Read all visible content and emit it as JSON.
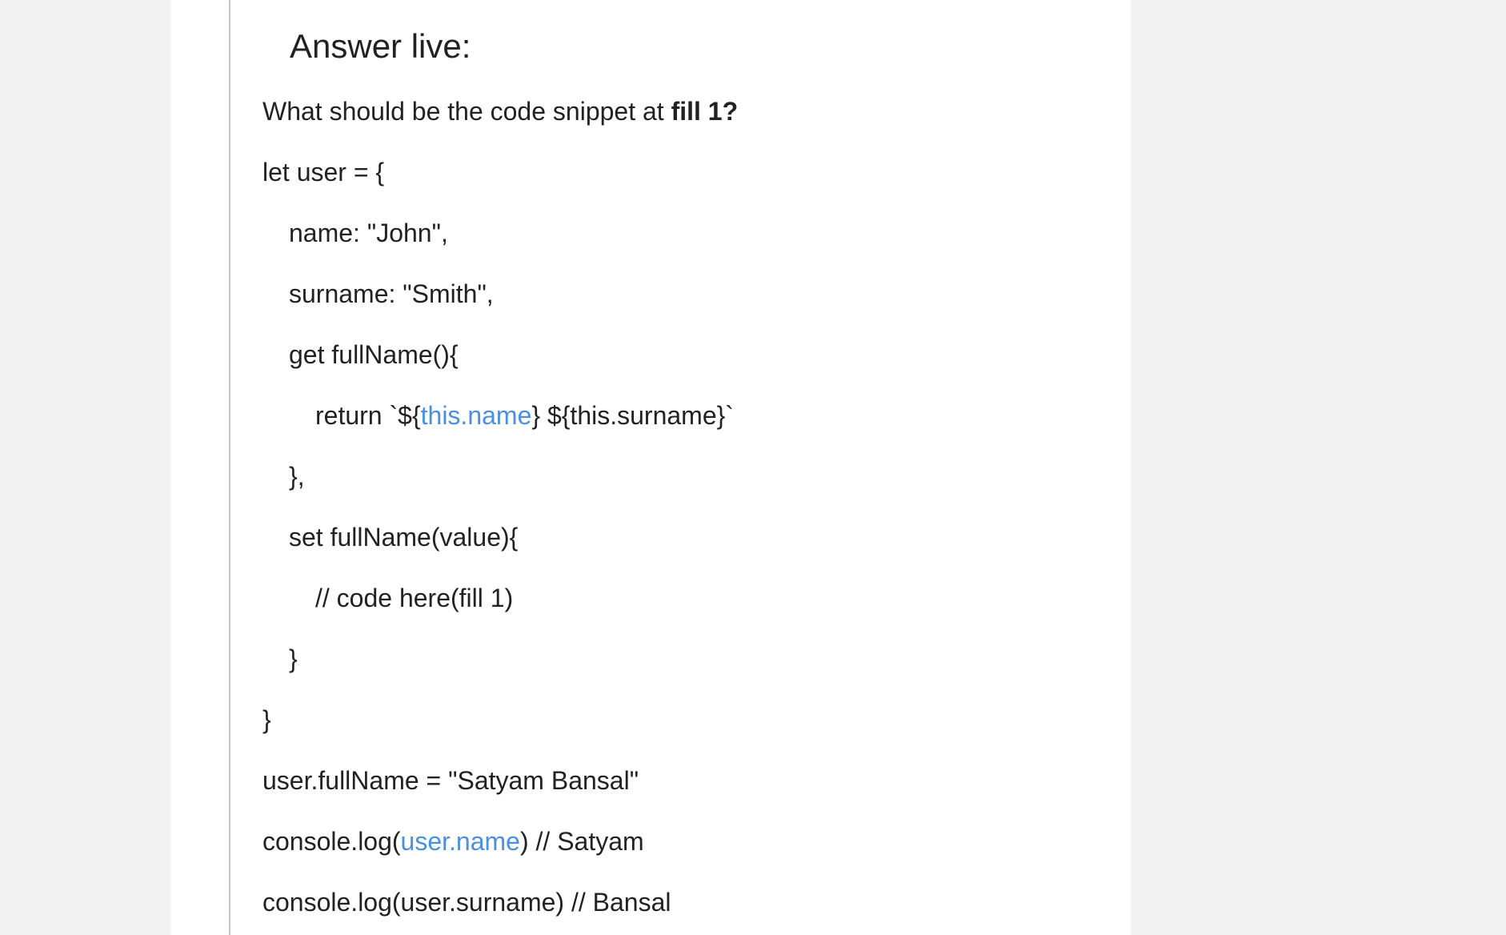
{
  "answer": {
    "heading": "Answer live:",
    "question_prefix": "What should be the code snippet at ",
    "question_bold": "fill 1?"
  },
  "code": {
    "l1": "let user = {",
    "l2": "name: \"John\",",
    "l3": "surname: \"Smith\",",
    "l4": "get fullName(){",
    "l5_pre": "return `${",
    "l5_link": "this.name",
    "l5_post": "} ${this.surname}`",
    "l6": "},",
    "l7": "set fullName(value){",
    "l8": "// code here(fill 1)",
    "l9": "}",
    "l10": "}",
    "l11": "user.fullName = \"Satyam Bansal\"",
    "l12_pre": "console.log(",
    "l12_link": "user.name",
    "l12_post": ") // Satyam",
    "l13": "console.log(user.surname) // Bansal"
  },
  "colors": {
    "link": "#4a90e2",
    "text": "#222222",
    "border": "#c4c4c4",
    "background": "#f2f2f2"
  }
}
